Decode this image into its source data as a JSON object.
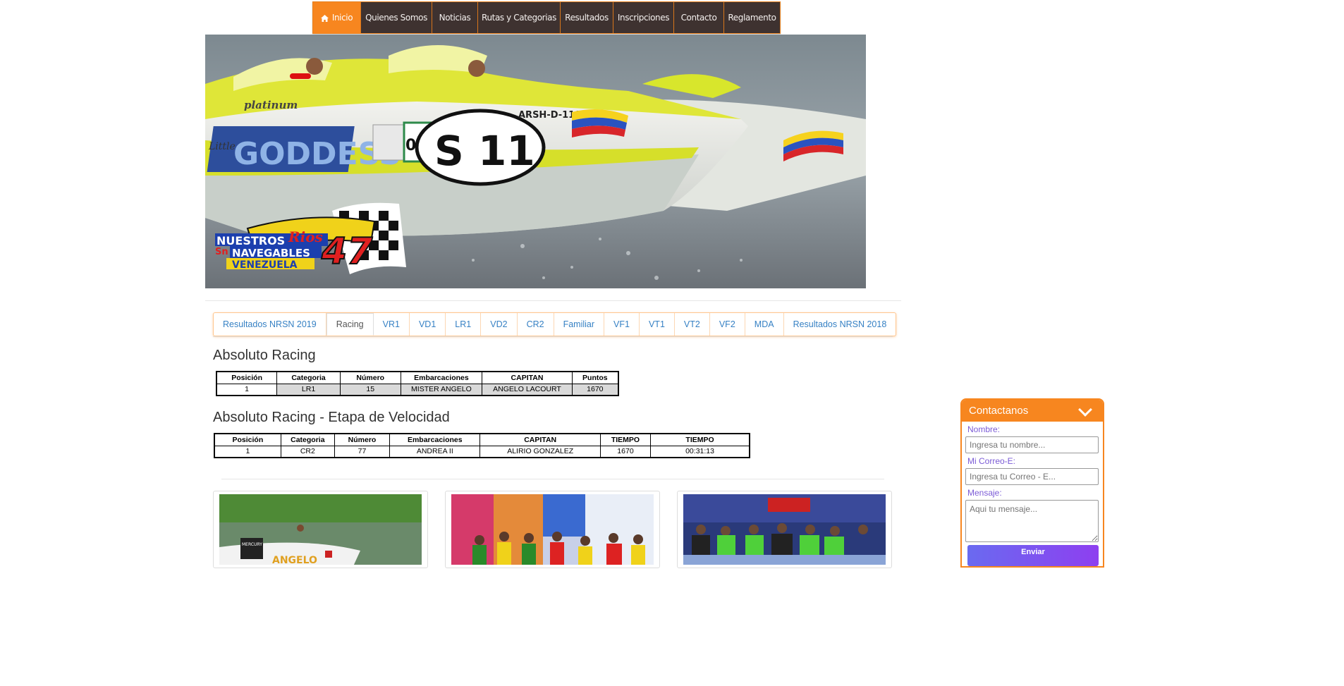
{
  "nav": {
    "items": [
      "Inicio",
      "Quienes Somos",
      "Noticias",
      "Rutas y Categorias",
      "Resultados",
      "Inscripciones",
      "Contacto",
      "Reglamento"
    ]
  },
  "hero": {
    "boat_brand": "platinum",
    "boat_name": "GODDESS",
    "boat_little": "Little",
    "boat_number": "S  11",
    "boat_side_number": "011",
    "boat_reg": "ARSH-D-1196",
    "logo_line1": "NUESTROS",
    "logo_line1b": "Rios",
    "logo_line2": "NAVEGABLES",
    "logo_line3": "VENEZUELA",
    "logo_number": "47",
    "logo_sn": "Sn"
  },
  "tabs": [
    "Resultados NRSN 2019",
    "Racing",
    "VR1",
    "VD1",
    "LR1",
    "VD2",
    "CR2",
    "Familiar",
    "VF1",
    "VT1",
    "VT2",
    "VF2",
    "MDA",
    "Resultados NRSN 2018"
  ],
  "section1": {
    "title": "Absoluto Racing",
    "headers": [
      "Posición",
      "Categoria",
      "Número",
      "Embarcaciones",
      "CAPITAN",
      "Puntos"
    ],
    "rows": [
      [
        "1",
        "LR1",
        "15",
        "MISTER ANGELO",
        "ANGELO LACOURT",
        "1670"
      ]
    ]
  },
  "section2": {
    "title": "Absoluto Racing - Etapa de Velocidad",
    "headers": [
      "Posición",
      "Categoria",
      "Número",
      "Embarcaciones",
      "CAPITAN",
      "TIEMPO",
      "TIEMPO"
    ],
    "rows": [
      [
        "1",
        "CR2",
        "77",
        "ANDREA II",
        "ALIRIO GONZALEZ",
        "1670",
        "00:31:13"
      ]
    ]
  },
  "cards": {
    "card1_boat_text": "ANGELO",
    "card1_engine": "MERCURY"
  },
  "contact": {
    "title": "Contactanos",
    "name_label": "Nombre:",
    "name_placeholder": "Ingresa tu nombre...",
    "email_label": "Mi Correo-E:",
    "email_placeholder": "Ingresa tu Correo - E...",
    "message_label": "Mensaje:",
    "message_placeholder": "Aqui tu mensaje...",
    "send_label": "Enviar"
  },
  "colors": {
    "accent": "#f7861f",
    "nav_bg": "#3e3230",
    "link": "#3681c4"
  }
}
